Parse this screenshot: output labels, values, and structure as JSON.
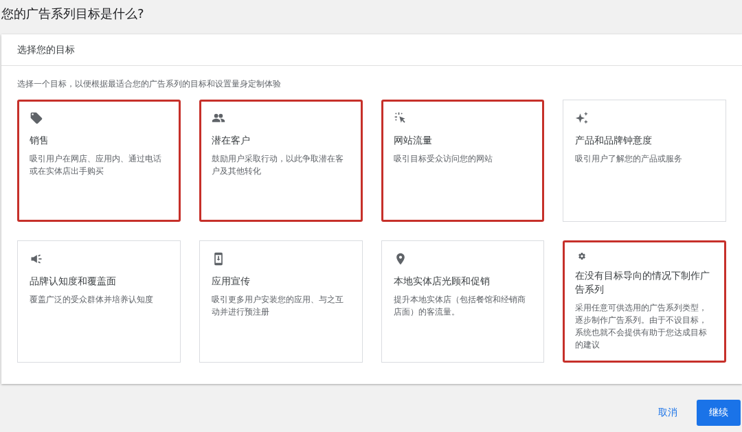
{
  "page_title": "您的广告系列目标是什么?",
  "panel": {
    "header": "选择您的目标",
    "intro": "选择一个目标，以便根据最适合您的广告系列的目标和设置量身定制体验",
    "goals": [
      {
        "title": "销售",
        "description": "吸引用户在网店、应用内、通过电话或在实体店出手购买",
        "highlighted": true
      },
      {
        "title": "潜在客户",
        "description": "鼓励用户采取行动，以此争取潜在客户及其他转化",
        "highlighted": true
      },
      {
        "title": "网站流量",
        "description": "吸引目标受众访问您的网站",
        "highlighted": true
      },
      {
        "title": "产品和品牌钟意度",
        "description": "吸引用户了解您的产品或服务",
        "highlighted": false
      },
      {
        "title": "品牌认知度和覆盖面",
        "description": "覆盖广泛的受众群体并培养认知度",
        "highlighted": false
      },
      {
        "title": "应用宣传",
        "description": "吸引更多用户安装您的应用、与之互动并进行预注册",
        "highlighted": false
      },
      {
        "title": "本地实体店光顾和促销",
        "description": "提升本地实体店（包括餐馆和经销商店面）的客流量。",
        "highlighted": false
      },
      {
        "title": "在没有目标导向的情况下制作广告系列",
        "description": "采用任意可供选用的广告系列类型，逐步制作广告系列。由于不设目标，系统也就不会提供有助于您达成目标的建议",
        "highlighted": true
      }
    ]
  },
  "buttons": [
    {
      "label": "取消",
      "kind": "text"
    },
    {
      "label": "继续",
      "kind": "primary"
    }
  ]
}
